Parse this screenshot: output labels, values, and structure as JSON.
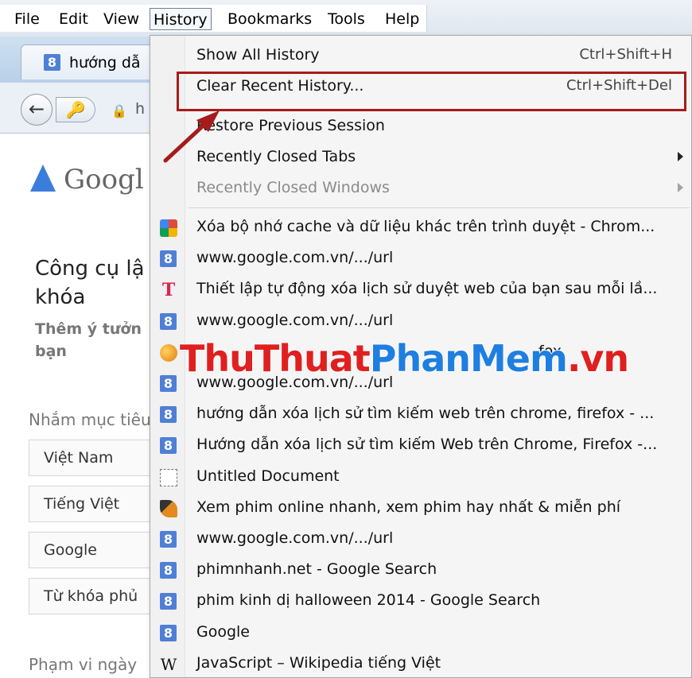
{
  "menubar": {
    "items": [
      "File",
      "Edit",
      "View",
      "History",
      "Bookmarks",
      "Tools",
      "Help"
    ],
    "active": "History"
  },
  "tab": {
    "favicon": "8",
    "title": "hướng dẫ"
  },
  "navbar": {
    "url_fragment": "h"
  },
  "page": {
    "logo_text": "Googl",
    "title": "Công cụ lậ khóa",
    "subtitle": "Thêm ý tưởn bạn",
    "targeting_label": "Nhắm mục tiêu",
    "fields": [
      "Việt Nam",
      "Tiếng Việt",
      "Google",
      "Từ khóa phủ"
    ],
    "date_range_label": "Phạm vi ngày"
  },
  "history_menu": {
    "top_items": [
      {
        "label": "Show All History",
        "shortcut": "Ctrl+Shift+H",
        "disabled": false,
        "submenu": false
      },
      {
        "label": "Clear Recent History...",
        "shortcut": "Ctrl+Shift+Del",
        "disabled": false,
        "submenu": false
      },
      {
        "label": "Restore Previous Session",
        "shortcut": "",
        "disabled": false,
        "submenu": false
      },
      {
        "label": "Recently Closed Tabs",
        "shortcut": "",
        "disabled": false,
        "submenu": true
      },
      {
        "label": "Recently Closed Windows",
        "shortcut": "",
        "disabled": true,
        "submenu": true
      }
    ],
    "history_entries": [
      {
        "icon": "chrome-icon",
        "label": "Xóa bộ nhớ cache và dữ liệu khác trên trình duyệt - Chrom..."
      },
      {
        "icon": "google-icon",
        "label": "www.google.com.vn/.../url"
      },
      {
        "icon": "t-icon",
        "label": "Thiết lập tự động xóa lịch sử duyệt web của bạn sau mỗi lầ..."
      },
      {
        "icon": "google-icon",
        "label": "www.google.com.vn/.../url"
      },
      {
        "icon": "firefox-icon",
        "label": "fox"
      },
      {
        "icon": "google-icon",
        "label": "www.google.com.vn/.../url"
      },
      {
        "icon": "google-icon",
        "label": "hướng dẫn xóa lịch sử tìm kiếm web trên chrome, firefox - ..."
      },
      {
        "icon": "google-icon",
        "label": "Hướng dẫn xóa lịch sử tìm kiếm Web trên Chrome, Firefox -..."
      },
      {
        "icon": "document-icon",
        "label": "Untitled Document"
      },
      {
        "icon": "leaf-icon",
        "label": "Xem phim online nhanh, xem phim hay nhất & miễn phí"
      },
      {
        "icon": "google-icon",
        "label": "www.google.com.vn/.../url"
      },
      {
        "icon": "google-icon",
        "label": "phimnhanh.net - Google Search"
      },
      {
        "icon": "google-icon",
        "label": "phim kinh dị halloween 2014 - Google Search"
      },
      {
        "icon": "google-icon",
        "label": "Google"
      },
      {
        "icon": "wikipedia-icon",
        "label": "JavaScript – Wikipedia tiếng Việt"
      }
    ]
  },
  "watermark": {
    "part1": "ThuThuat",
    "part2": "PhanMem",
    "part3": ".vn"
  },
  "colors": {
    "highlight": "#a61b1b",
    "google_blue": "#4f7fd6",
    "watermark_red": "#e02020",
    "watermark_blue": "#1f7fe0"
  }
}
